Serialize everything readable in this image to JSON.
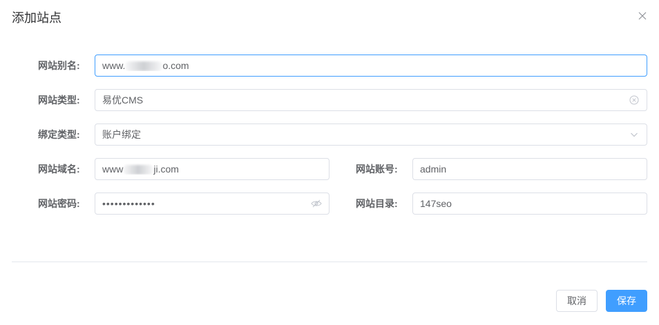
{
  "dialog": {
    "title": "添加站点"
  },
  "form": {
    "site_alias": {
      "label": "网站别名:",
      "value_prefix": "www.",
      "value_suffix": "o.com"
    },
    "site_type": {
      "label": "网站类型:",
      "value": "易优CMS"
    },
    "bind_type": {
      "label": "绑定类型:",
      "value": "账户绑定"
    },
    "site_domain": {
      "label": "网站域名:",
      "value_prefix": "www",
      "value_suffix": "ji.com"
    },
    "site_account": {
      "label": "网站账号:",
      "value": "admin"
    },
    "site_password": {
      "label": "网站密码:",
      "value": "•••••••••••••"
    },
    "site_directory": {
      "label": "网站目录:",
      "value": "147seo"
    }
  },
  "footer": {
    "cancel_label": "取消",
    "save_label": "保存"
  },
  "icons": {
    "close": "close-icon",
    "clear": "circle-close-icon",
    "dropdown": "chevron-down-icon",
    "password_toggle": "eye-off-icon"
  },
  "colors": {
    "primary": "#409eff",
    "border": "#dcdfe6",
    "label": "#606266",
    "title": "#303133"
  }
}
